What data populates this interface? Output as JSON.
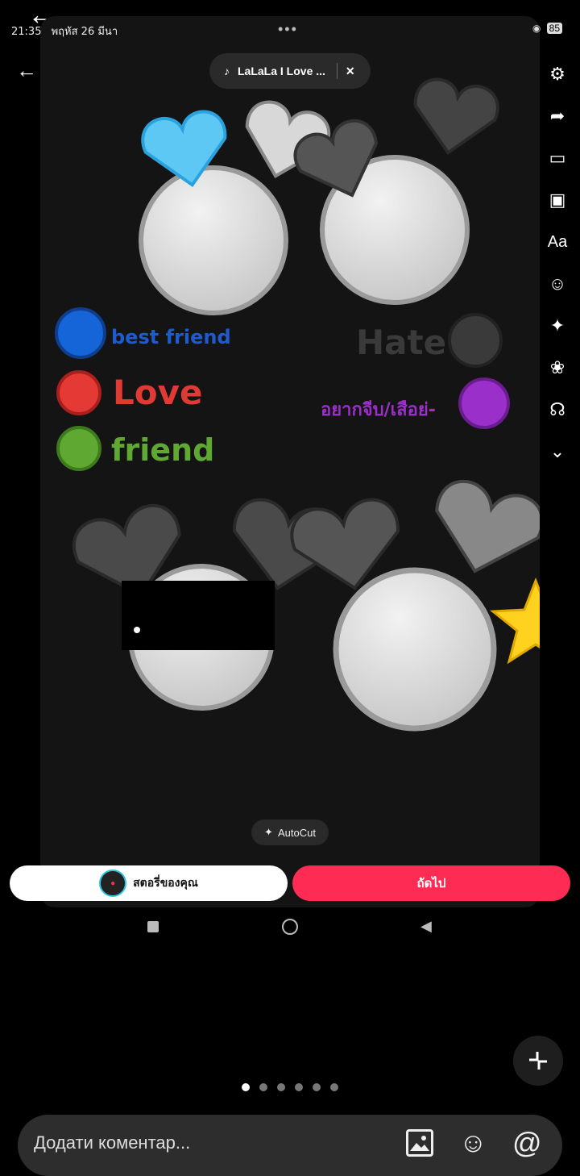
{
  "status_bar": {
    "time": "21:35",
    "date": "พฤหัส 26 มีนา",
    "battery": "85"
  },
  "music": {
    "title": "LaLaLa I Love ..."
  },
  "legend": {
    "best_friend": "best friend",
    "love": "Love",
    "friend": "friend",
    "hate": "Hate",
    "crush": "อยากจีบ/เสือย่-"
  },
  "colors": {
    "best_friend": "#1565d8",
    "love": "#e53935",
    "friend": "#5fa832",
    "hate": "#3a3a3a",
    "crush": "#9b2fc9",
    "accent": "#fe2c55"
  },
  "autocut": "AutoCut",
  "story_button": "สตอรี่ของคุณ",
  "next_button": "ถัดไป",
  "comment_placeholder": "Додати коментар...",
  "pager": {
    "count": 6,
    "active": 1
  },
  "icons": [
    "back-arrow-icon",
    "settings-icon",
    "share-icon",
    "crop-icon",
    "video-sticker-icon",
    "text-icon",
    "sticker-icon",
    "effects-icon",
    "filters-icon",
    "voice-icon",
    "chevron-down-icon",
    "image-icon",
    "emoji-icon",
    "mention-icon",
    "collapse-icon"
  ]
}
